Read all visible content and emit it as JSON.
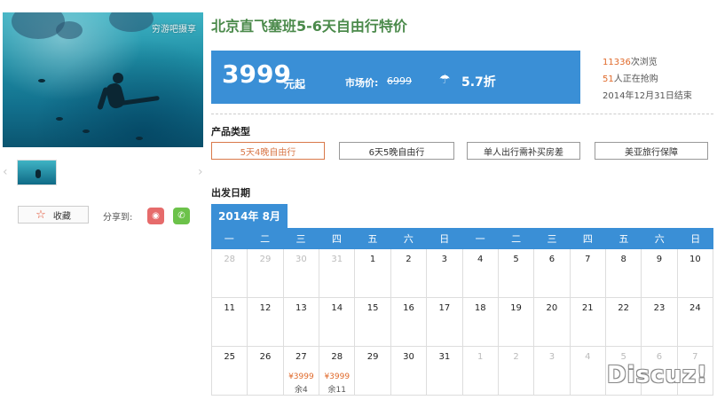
{
  "product": {
    "title": "北京直飞塞班5-6天自由行特价",
    "photo_watermark": "穷游吧摄享"
  },
  "price": {
    "amount": "3999",
    "unit": "元起",
    "market_label": "市场价:",
    "market_value": "6999",
    "discount": "5.7折"
  },
  "stats": {
    "views_num": "11336",
    "views_text": "次浏览",
    "buying_num": "51",
    "buying_text": "人正在抢购",
    "end_text": "2014年12月31日结束"
  },
  "actions": {
    "favorite_label": "收藏",
    "share_label": "分享到:"
  },
  "product_types": {
    "title": "产品类型",
    "options": [
      "5天4晚自由行",
      "6天5晚自由行",
      "单人出行需补买房差",
      "美亚旅行保障"
    ],
    "selected": 0
  },
  "calendar": {
    "title": "出发日期",
    "month": "2014年 8月",
    "weekdays": [
      "一",
      "二",
      "三",
      "四",
      "五",
      "六",
      "日",
      "一",
      "二",
      "三",
      "四",
      "五",
      "六",
      "日"
    ],
    "rows": [
      [
        {
          "d": "28",
          "m": true
        },
        {
          "d": "29",
          "m": true
        },
        {
          "d": "30",
          "m": true
        },
        {
          "d": "31",
          "m": true
        },
        {
          "d": "1"
        },
        {
          "d": "2"
        },
        {
          "d": "3"
        },
        {
          "d": "4"
        },
        {
          "d": "5"
        },
        {
          "d": "6"
        },
        {
          "d": "7"
        },
        {
          "d": "8"
        },
        {
          "d": "9"
        },
        {
          "d": "10"
        }
      ],
      [
        {
          "d": "11"
        },
        {
          "d": "12"
        },
        {
          "d": "13"
        },
        {
          "d": "14"
        },
        {
          "d": "15"
        },
        {
          "d": "16"
        },
        {
          "d": "17"
        },
        {
          "d": "18"
        },
        {
          "d": "19"
        },
        {
          "d": "20"
        },
        {
          "d": "21"
        },
        {
          "d": "22"
        },
        {
          "d": "23"
        },
        {
          "d": "24"
        }
      ],
      [
        {
          "d": "25"
        },
        {
          "d": "26"
        },
        {
          "d": "27",
          "p": "¥3999",
          "r": "余4"
        },
        {
          "d": "28",
          "p": "¥3999",
          "r": "余11"
        },
        {
          "d": "29"
        },
        {
          "d": "30"
        },
        {
          "d": "31"
        },
        {
          "d": "1",
          "m": true
        },
        {
          "d": "2",
          "m": true
        },
        {
          "d": "3",
          "m": true
        },
        {
          "d": "4",
          "m": true
        },
        {
          "d": "5",
          "m": true
        },
        {
          "d": "6",
          "m": true
        },
        {
          "d": "7",
          "m": true
        }
      ]
    ]
  },
  "site_watermark": "Discuz!"
}
